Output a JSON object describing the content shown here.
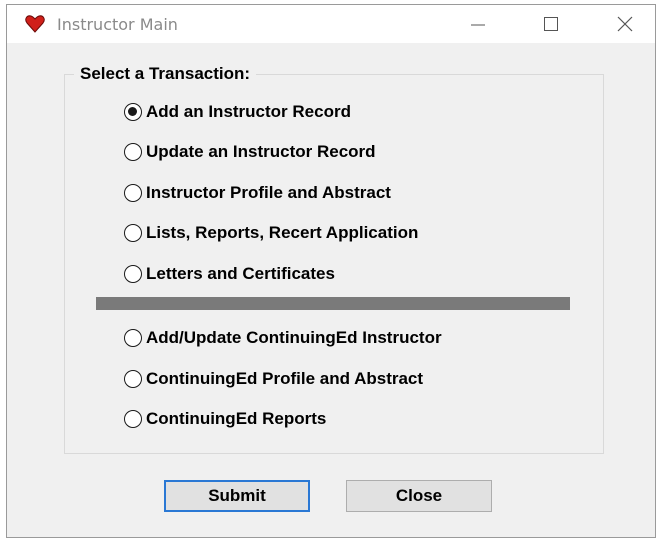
{
  "window": {
    "title": "Instructor Main",
    "icon": "heart-icon",
    "controls": [
      "minimize-icon",
      "maximize-icon",
      "close-icon"
    ]
  },
  "group": {
    "legend": "Select a Transaction:"
  },
  "options_top": [
    {
      "label": "Add an Instructor Record",
      "checked": true
    },
    {
      "label": "Update an Instructor Record",
      "checked": false
    },
    {
      "label": "Instructor Profile and Abstract",
      "checked": false
    },
    {
      "label": "Lists, Reports, Recert Application",
      "checked": false
    },
    {
      "label": "Letters and Certificates",
      "checked": false
    }
  ],
  "options_bottom": [
    {
      "label": "Add/Update ContinuingEd Instructor",
      "checked": false
    },
    {
      "label": "ContinuingEd Profile and Abstract",
      "checked": false
    },
    {
      "label": "ContinuingEd Reports",
      "checked": false
    }
  ],
  "buttons": {
    "submit": "Submit",
    "close": "Close"
  },
  "colors": {
    "window_bg": "#f0f0f0",
    "separator": "#7a7a7a",
    "default_button_border": "#2a78d4",
    "icon_red": "#d0201a"
  }
}
